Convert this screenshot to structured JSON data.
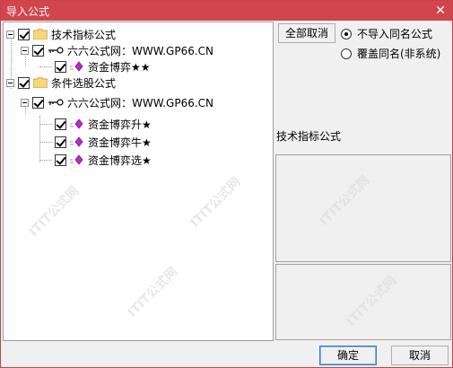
{
  "window": {
    "title": "导入公式",
    "close_glyph": "✕"
  },
  "tree": {
    "groups": [
      {
        "label": "技术指标公式",
        "source": "六六公式网：WWW.GP66.CN",
        "items": [
          "资金博弈★★"
        ]
      },
      {
        "label": "条件选股公式",
        "source": "六六公式网：WWW.GP66.CN",
        "items": [
          "资金博弈升★",
          "资金博弈牛★",
          "资金博弈选★"
        ]
      }
    ]
  },
  "options": {
    "uncheck_all_label": "全部取消",
    "radio_no_import": "不导入同名公式",
    "radio_overwrite": "覆盖同名(非系统)",
    "selected": "no_import"
  },
  "detail": {
    "type_label": "技术指标公式"
  },
  "buttons": {
    "ok": "确定",
    "cancel": "取消"
  },
  "colors": {
    "title_bar": "#d2454d",
    "folder": "#f5d67b",
    "item_icon": "#c026d3"
  },
  "watermark": "ITIT公式网"
}
